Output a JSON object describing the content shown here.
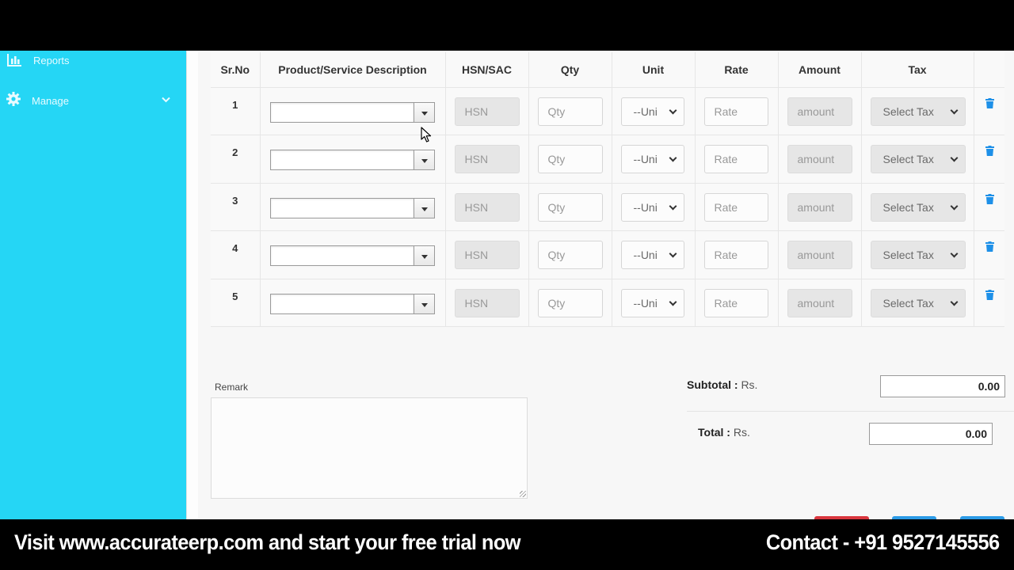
{
  "sidebar": {
    "items": [
      {
        "label": "Reports",
        "icon": "bar-chart-icon"
      },
      {
        "label": "Manage",
        "icon": "gear-icon",
        "expandable": true
      }
    ]
  },
  "table": {
    "headers": [
      "Sr.No",
      "Product/Service Description",
      "HSN/SAC",
      "Qty",
      "Unit",
      "Rate",
      "Amount",
      "Tax"
    ],
    "rows": [
      {
        "sr": "1",
        "hsn_placeholder": "HSN",
        "qty_placeholder": "Qty",
        "unit": "--Uni",
        "rate_placeholder": "Rate",
        "amount_placeholder": "amount",
        "tax": "Select Tax"
      },
      {
        "sr": "2",
        "hsn_placeholder": "HSN",
        "qty_placeholder": "Qty",
        "unit": "--Uni",
        "rate_placeholder": "Rate",
        "amount_placeholder": "amount",
        "tax": "Select Tax"
      },
      {
        "sr": "3",
        "hsn_placeholder": "HSN",
        "qty_placeholder": "Qty",
        "unit": "--Uni",
        "rate_placeholder": "Rate",
        "amount_placeholder": "amount",
        "tax": "Select Tax"
      },
      {
        "sr": "4",
        "hsn_placeholder": "HSN",
        "qty_placeholder": "Qty",
        "unit": "--Uni",
        "rate_placeholder": "Rate",
        "amount_placeholder": "amount",
        "tax": "Select Tax"
      },
      {
        "sr": "5",
        "hsn_placeholder": "HSN",
        "qty_placeholder": "Qty",
        "unit": "--Uni",
        "rate_placeholder": "Rate",
        "amount_placeholder": "amount",
        "tax": "Select Tax"
      }
    ]
  },
  "remark": {
    "label": "Remark",
    "value": ""
  },
  "totals": {
    "subtotal_label": "Subtotal :",
    "total_label": "Total :",
    "currency": "Rs.",
    "subtotal_value": "0.00",
    "total_value": "0.00"
  },
  "banner": {
    "left": "Visit www.accurateerp.com and start your free trial now",
    "right": "Contact - +91 9527145556"
  },
  "colors": {
    "sidebar": "#25d6f5",
    "delete_icon": "#1e90e8",
    "btn_red": "#d9363e",
    "btn_blue": "#2c9be6"
  }
}
